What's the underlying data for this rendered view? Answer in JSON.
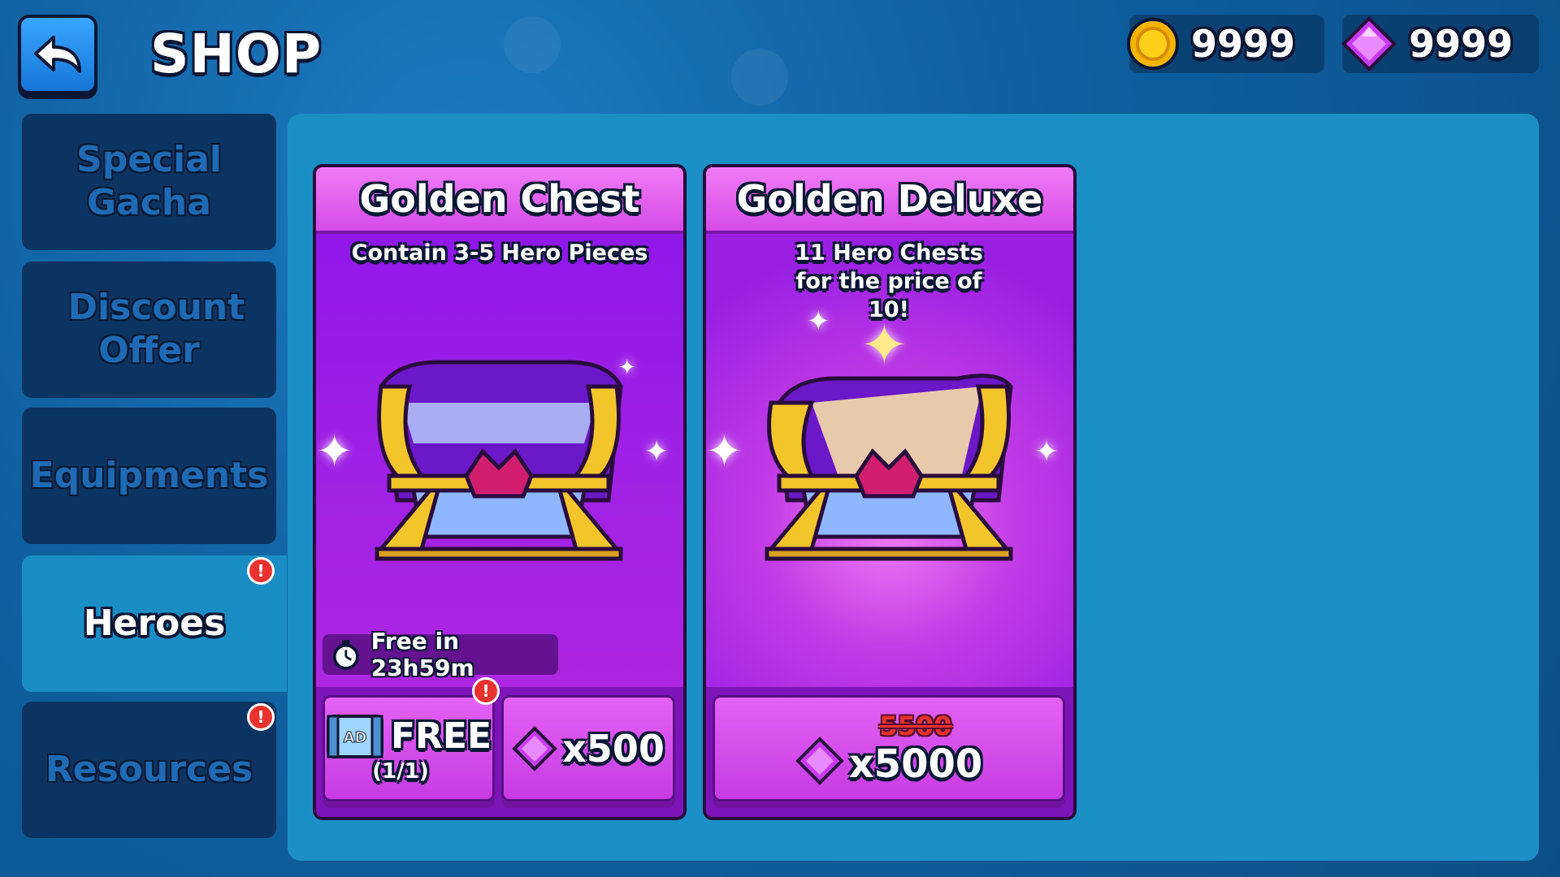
{
  "header": {
    "title": "SHOP"
  },
  "currency": {
    "coins": "9999",
    "gems": "9999"
  },
  "sidebar": {
    "items": [
      {
        "label": "Special Gacha",
        "active": false,
        "alert": false
      },
      {
        "label": "Discount Offer",
        "active": false,
        "alert": false
      },
      {
        "label": "Equipments",
        "active": false,
        "alert": false
      },
      {
        "label": "Heroes",
        "active": true,
        "alert": true
      },
      {
        "label": "Resources",
        "active": false,
        "alert": true
      }
    ]
  },
  "cards": [
    {
      "title": "Golden Chest",
      "description": "Contain 3-5 Hero Pieces",
      "timer": "Free in 23h59m",
      "free_button": {
        "label": "FREE",
        "count": "(1/1)",
        "ad_label": "AD"
      },
      "gem_button": {
        "price": "x500"
      }
    },
    {
      "title": "Golden Deluxe",
      "description": "11 Hero Chests for the price of 10!",
      "gem_button": {
        "old_price": "5500",
        "price": "x5000"
      }
    }
  ],
  "colors": {
    "coin": "#f5b400",
    "gem": "#b224e0",
    "alert": "#e8322e",
    "active_tab": "#1a8ec4"
  },
  "icons": [
    "back-arrow-icon",
    "coin-icon",
    "gem-icon",
    "stopwatch-icon",
    "ad-video-icon",
    "sparkle-icon",
    "chest-icon"
  ]
}
